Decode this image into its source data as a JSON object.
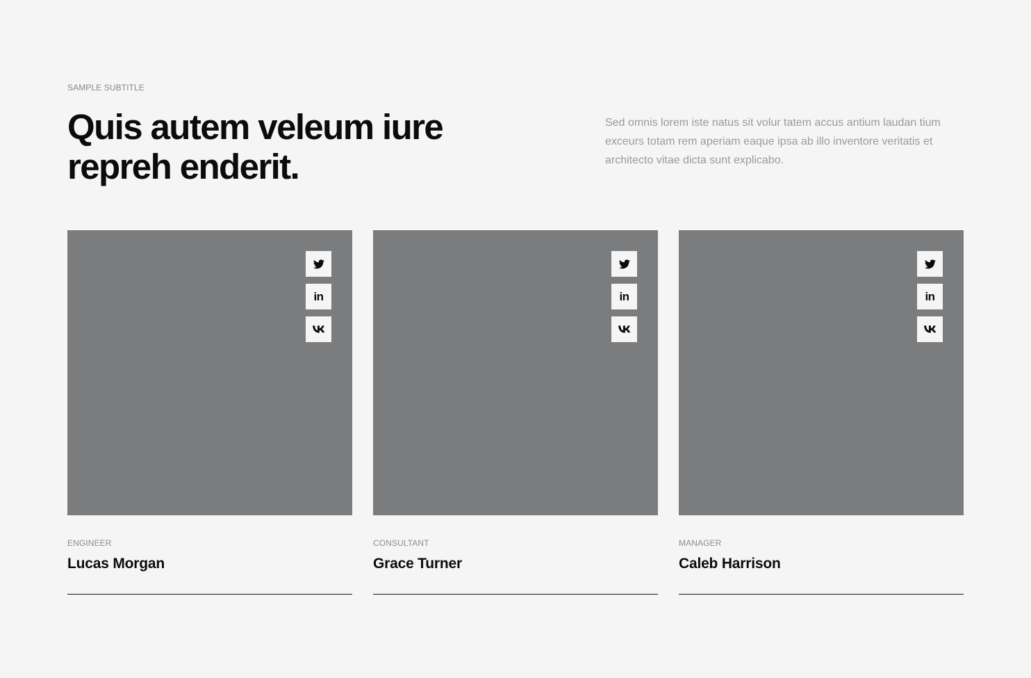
{
  "header": {
    "subtitle": "SAMPLE SUBTITLE",
    "title_line1": "Quis autem veleum iure",
    "title_line2": "repreh enderit.",
    "intro": "Sed omnis lorem iste natus sit volur tatem accus antium laudan tium exceurs totam rem aperiam eaque ipsa ab illo inventore veritatis et architecto vitae dicta sunt explicabo."
  },
  "colors": {
    "background": "#f5f5f5",
    "photo_placeholder": "#7b7c7e",
    "text": "#0b0b0b",
    "muted": "#9a9a9a"
  },
  "team": [
    {
      "role": "ENGINEER",
      "name": "Lucas Morgan",
      "socials": [
        {
          "icon": "twitter-icon"
        },
        {
          "icon": "linkedin-icon",
          "glyph": "in"
        },
        {
          "icon": "vk-icon"
        }
      ]
    },
    {
      "role": "CONSULTANT",
      "name": "Grace Turner",
      "socials": [
        {
          "icon": "twitter-icon"
        },
        {
          "icon": "linkedin-icon",
          "glyph": "in"
        },
        {
          "icon": "vk-icon"
        }
      ]
    },
    {
      "role": "MANAGER",
      "name": "Caleb Harrison",
      "socials": [
        {
          "icon": "twitter-icon"
        },
        {
          "icon": "linkedin-icon",
          "glyph": "in"
        },
        {
          "icon": "vk-icon"
        }
      ]
    }
  ]
}
